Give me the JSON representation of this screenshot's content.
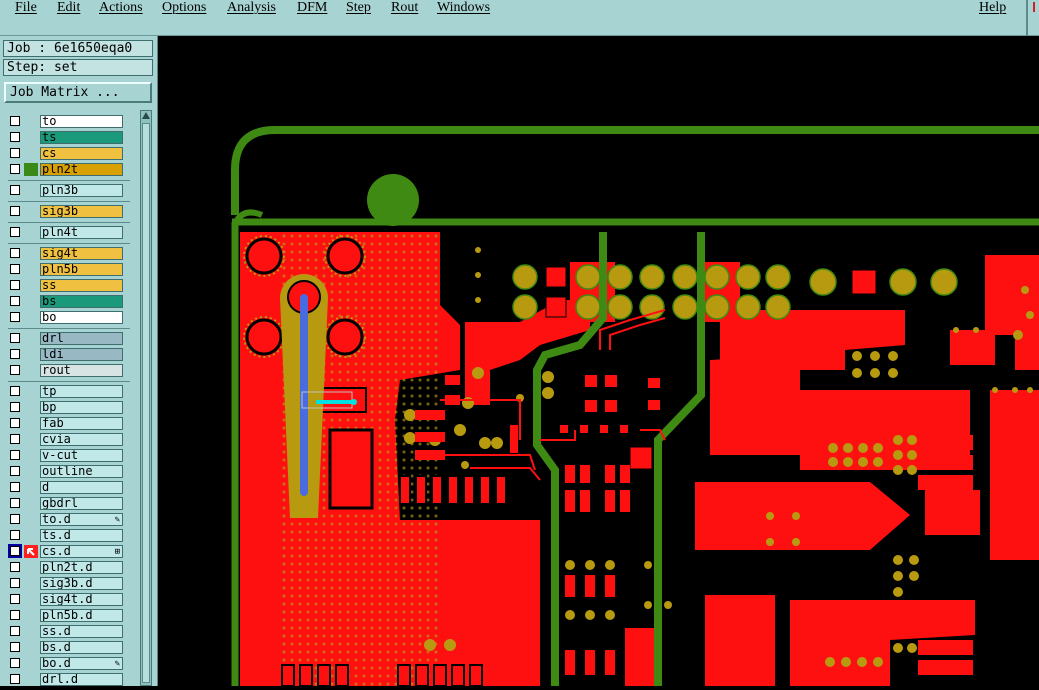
{
  "menubar": {
    "items": [
      "File",
      "Edit",
      "Actions",
      "Options",
      "Analysis",
      "DFM",
      "Step",
      "Rout",
      "Windows"
    ],
    "help": "Help"
  },
  "job": {
    "label": "Job : 6e1650eqa0"
  },
  "step": {
    "label": "Step: set"
  },
  "job_matrix": {
    "label": "Job Matrix ..."
  },
  "layers": [
    {
      "name": "to",
      "color": "#ffffff"
    },
    {
      "name": "ts",
      "color": "#1a9a7a"
    },
    {
      "name": "cs",
      "color": "#f0c040"
    },
    {
      "name": "pln2t",
      "color": "#d8a000",
      "mark": "#3a8a1a"
    },
    {
      "name": "pln3b",
      "color": "#c0e8e8"
    },
    {
      "name": "sig3b",
      "color": "#f0c040"
    },
    {
      "name": "pln4t",
      "color": "#c0e8e8"
    },
    {
      "name": "sig4t",
      "color": "#f0c040"
    },
    {
      "name": "pln5b",
      "color": "#f0c040"
    },
    {
      "name": "ss",
      "color": "#f0c040"
    },
    {
      "name": "bs",
      "color": "#1a9a7a"
    },
    {
      "name": "bo",
      "color": "#ffffff"
    },
    {
      "name": "drl",
      "color": "#98b8c4"
    },
    {
      "name": "ldi",
      "color": "#98b8c4"
    },
    {
      "name": "rout",
      "color": "#d8e4e4"
    },
    {
      "name": "tp",
      "color": "#c0e8e8"
    },
    {
      "name": "bp",
      "color": "#c0e8e8"
    },
    {
      "name": "fab",
      "color": "#c0e8e8"
    },
    {
      "name": "cvia",
      "color": "#c0e8e8"
    },
    {
      "name": "v-cut",
      "color": "#c0e8e8"
    },
    {
      "name": "outline",
      "color": "#c0e8e8"
    },
    {
      "name": "d",
      "color": "#c0e8e8"
    },
    {
      "name": "gbdrl",
      "color": "#c0e8e8"
    },
    {
      "name": "to.d",
      "color": "#c0e8e8"
    },
    {
      "name": "ts.d",
      "color": "#c0e8e8"
    },
    {
      "name": "cs.d",
      "color": "#c0e8e8",
      "selected": true
    },
    {
      "name": "pln2t.d",
      "color": "#c0e8e8"
    },
    {
      "name": "sig3b.d",
      "color": "#c0e8e8"
    },
    {
      "name": "sig4t.d",
      "color": "#c0e8e8"
    },
    {
      "name": "pln5b.d",
      "color": "#c0e8e8"
    },
    {
      "name": "ss.d",
      "color": "#c0e8e8"
    },
    {
      "name": "bs.d",
      "color": "#c0e8e8"
    },
    {
      "name": "bo.d",
      "color": "#c0e8e8"
    },
    {
      "name": "drl.d",
      "color": "#c0e8e8"
    }
  ],
  "colors": {
    "panel": "#a7d3d3",
    "copper": "#ff1010",
    "outline": "#3f8a12",
    "pad": "#b89a10",
    "cursor": "#00e0e0"
  }
}
